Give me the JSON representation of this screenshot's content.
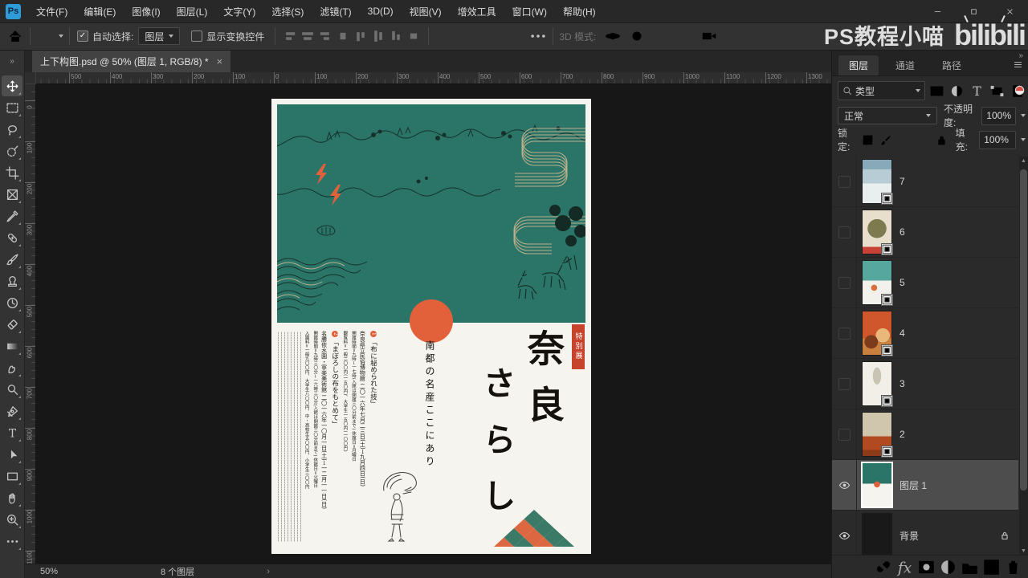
{
  "window": {
    "controls": [
      "minimize",
      "maximize",
      "close"
    ]
  },
  "watermark": {
    "channel": "PS教程小喵",
    "brand": "bilibili"
  },
  "ui": {
    "collapse_glyph": "»",
    "check_glyph": "✓",
    "status_chevron": "›",
    "scroll_up": "▲",
    "scroll_down": "▼"
  },
  "menu_bar": {
    "logo": "Ps",
    "items": [
      "文件(F)",
      "编辑(E)",
      "图像(I)",
      "图层(L)",
      "文字(Y)",
      "选择(S)",
      "滤镜(T)",
      "3D(D)",
      "视图(V)",
      "增效工具",
      "窗口(W)",
      "帮助(H)"
    ]
  },
  "options_bar": {
    "auto_select_label": "自动选择:",
    "auto_select_checked": true,
    "target_value": "图层",
    "show_transform_label": "显示变换控件",
    "show_transform_checked": false,
    "align_icons": [
      "align-left",
      "align-center-h",
      "align-right",
      "distribute-h",
      "align-top",
      "align-center-v",
      "align-bottom",
      "distribute-v"
    ],
    "mode_3d_label": "3D 模式:",
    "mode_3d_icons": [
      "3d-orbit",
      "3d-roll",
      "3d-pan",
      "3d-slide",
      "3d-camera"
    ]
  },
  "document": {
    "tab_title": "上下构图.psd @ 50% (图层 1, RGB/8) *",
    "close_glyph": "×",
    "zoom_level": "50%",
    "status_text": "8 个图层",
    "ruler_h": [
      "500",
      "400",
      "300",
      "200",
      "100",
      "0",
      "100",
      "200",
      "300",
      "400",
      "500",
      "600",
      "700",
      "800",
      "900",
      "1000",
      "1100",
      "1200",
      "1300"
    ],
    "ruler_v": [
      "0",
      "100",
      "200",
      "300",
      "400",
      "500",
      "600",
      "700",
      "800",
      "900",
      "1000",
      "1100"
    ]
  },
  "toolbar": {
    "tools": [
      {
        "name": "move",
        "selected": true
      },
      {
        "name": "marquee"
      },
      {
        "name": "lasso"
      },
      {
        "name": "object-select"
      },
      {
        "name": "crop"
      },
      {
        "name": "frame"
      },
      {
        "name": "eyedropper"
      },
      {
        "name": "healing"
      },
      {
        "name": "brush"
      },
      {
        "name": "stamp"
      },
      {
        "name": "history-brush"
      },
      {
        "name": "eraser"
      },
      {
        "name": "gradient"
      },
      {
        "name": "smudge"
      },
      {
        "name": "dodge"
      },
      {
        "name": "pen"
      },
      {
        "name": "type"
      },
      {
        "name": "path-select"
      },
      {
        "name": "rectangle"
      },
      {
        "name": "hand"
      },
      {
        "name": "zoom"
      },
      {
        "name": "ellipsis"
      }
    ]
  },
  "panels": {
    "tabs": [
      {
        "label": "图层",
        "active": true
      },
      {
        "label": "通道",
        "active": false
      },
      {
        "label": "路径",
        "active": false
      }
    ],
    "filter": {
      "search_value": "类型",
      "icons": [
        "pixel-filter",
        "adjustment-filter",
        "type-filter",
        "shape-filter",
        "smartobject-filter"
      ]
    },
    "blend_mode": "正常",
    "opacity_label": "不透明度:",
    "opacity_value": "100%",
    "lock_label": "锁定:",
    "lock_icons": [
      "lock-transparent",
      "lock-pixels",
      "lock-position",
      "lock-artboard",
      "lock-all"
    ],
    "fill_label": "填充:",
    "fill_value": "100%",
    "layers": [
      {
        "name": "7",
        "thumb": "thumb7",
        "visible": false,
        "smart": true
      },
      {
        "name": "6",
        "thumb": "thumb6",
        "visible": false,
        "smart": true
      },
      {
        "name": "5",
        "thumb": "thumb5",
        "visible": false,
        "smart": true
      },
      {
        "name": "4",
        "thumb": "thumb4",
        "visible": false,
        "smart": true
      },
      {
        "name": "3",
        "thumb": "thumb3",
        "visible": false,
        "smart": true
      },
      {
        "name": "2",
        "thumb": "thumb2",
        "visible": false,
        "smart": true
      },
      {
        "name": "图层 1",
        "thumb": "thumb1",
        "visible": true,
        "selected": true
      },
      {
        "name": "背景",
        "thumb": "thumbBg",
        "visible": true,
        "locked": true
      }
    ],
    "bottom_icons": [
      "link",
      "fx",
      "mask",
      "adjustment",
      "group",
      "new-layer",
      "delete"
    ]
  },
  "poster": {
    "badge": "特別展",
    "title_col1": "奈良",
    "title_col2": "さらし",
    "subtitle": "南都の名産ここにあり",
    "columns": [
      {
        "bullet": "1",
        "text": "「布に秘められた技」",
        "size": "md"
      },
      {
        "text": "奈良県立民俗博物館 二〇一六年七月二三日(土)→九月四日(日)",
        "size": "sm"
      },
      {
        "text": "開館時間=九時→一七時(入館は閉館三〇分前まで) 休館日=月曜日",
        "size": "xs"
      },
      {
        "text": "観覧料=一般二〇〇円(一五〇円)、大学生一五〇円(一〇〇円)",
        "size": "xs"
      },
      {
        "bullet": "2",
        "text": "「まぼろしの布をもとめて」",
        "size": "md"
      },
      {
        "text": "名勝依水園・寧楽美術館 二〇一六年一〇月一日(土)→一二月一一日(日)",
        "size": "sm"
      },
      {
        "text": "開館時間=九時三〇分→一六時三〇分(入館は閉館三〇分前まで) 休館日=火曜日",
        "size": "xs"
      },
      {
        "text": "入園料=一般九〇〇円、大学生八〇〇円、中・高校生五〇〇円、小学生三〇〇円",
        "size": "xs"
      }
    ],
    "colors": {
      "green": "#2b7568",
      "orange": "#e2603a",
      "badge_red": "#c8432b",
      "ink": "#16312b",
      "tan": "#bdb08b",
      "tri_green": "#3c7a68",
      "tri_orange": "#dd6740"
    }
  }
}
